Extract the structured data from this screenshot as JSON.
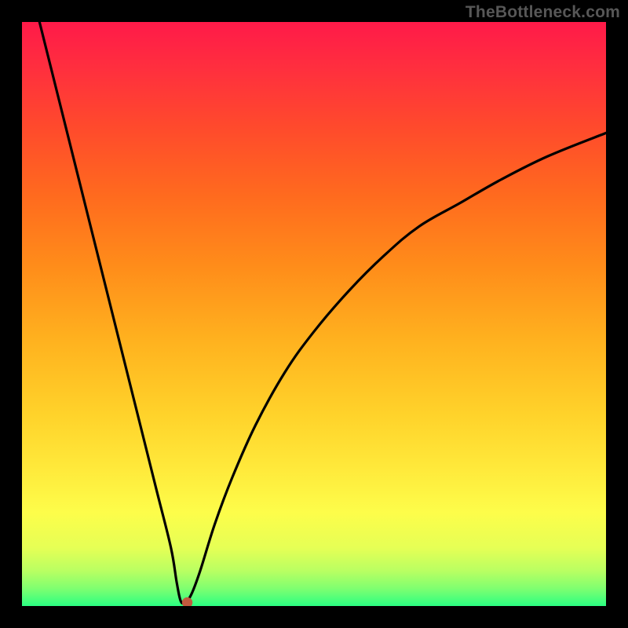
{
  "watermark": "TheBottleneck.com",
  "chart_data": {
    "type": "line",
    "title": "",
    "xlabel": "",
    "ylabel": "",
    "xlim": [
      0,
      100
    ],
    "ylim": [
      0,
      100
    ],
    "grid": false,
    "notes": "V-shaped bottleneck curve over a red-to-green vertical gradient. Minimum near x≈27, y≈0. Left branch falls steeply from top-left; right branch rises concavely toward y≈80 at x=100.",
    "gradient_stops": [
      {
        "offset": 0.0,
        "color": "#ff1a49"
      },
      {
        "offset": 0.08,
        "color": "#ff2f3e"
      },
      {
        "offset": 0.18,
        "color": "#ff4a2c"
      },
      {
        "offset": 0.3,
        "color": "#ff6b1e"
      },
      {
        "offset": 0.42,
        "color": "#ff8d1a"
      },
      {
        "offset": 0.55,
        "color": "#ffb31f"
      },
      {
        "offset": 0.67,
        "color": "#ffd22a"
      },
      {
        "offset": 0.76,
        "color": "#ffe83a"
      },
      {
        "offset": 0.84,
        "color": "#fdfd4a"
      },
      {
        "offset": 0.9,
        "color": "#e6ff55"
      },
      {
        "offset": 0.94,
        "color": "#b9ff62"
      },
      {
        "offset": 0.97,
        "color": "#7fff70"
      },
      {
        "offset": 1.0,
        "color": "#2bff82"
      }
    ],
    "series": [
      {
        "name": "curve",
        "x": [
          3,
          5,
          8,
          11,
          14,
          17,
          20,
          23,
          25.5,
          26.5,
          27.2,
          28,
          29,
          30.5,
          33,
          36,
          40,
          45,
          50,
          56,
          62,
          68,
          75,
          82,
          90,
          100
        ],
        "y": [
          100,
          92,
          80,
          68,
          56,
          44,
          32,
          20,
          10,
          4,
          0.8,
          0.7,
          2,
          6,
          14,
          22,
          31,
          40,
          47,
          54,
          60,
          65,
          69,
          73,
          77,
          81
        ]
      }
    ],
    "marker": {
      "x": 28.3,
      "y": 0.6,
      "color": "#c25a3f",
      "r": 0.9
    }
  }
}
